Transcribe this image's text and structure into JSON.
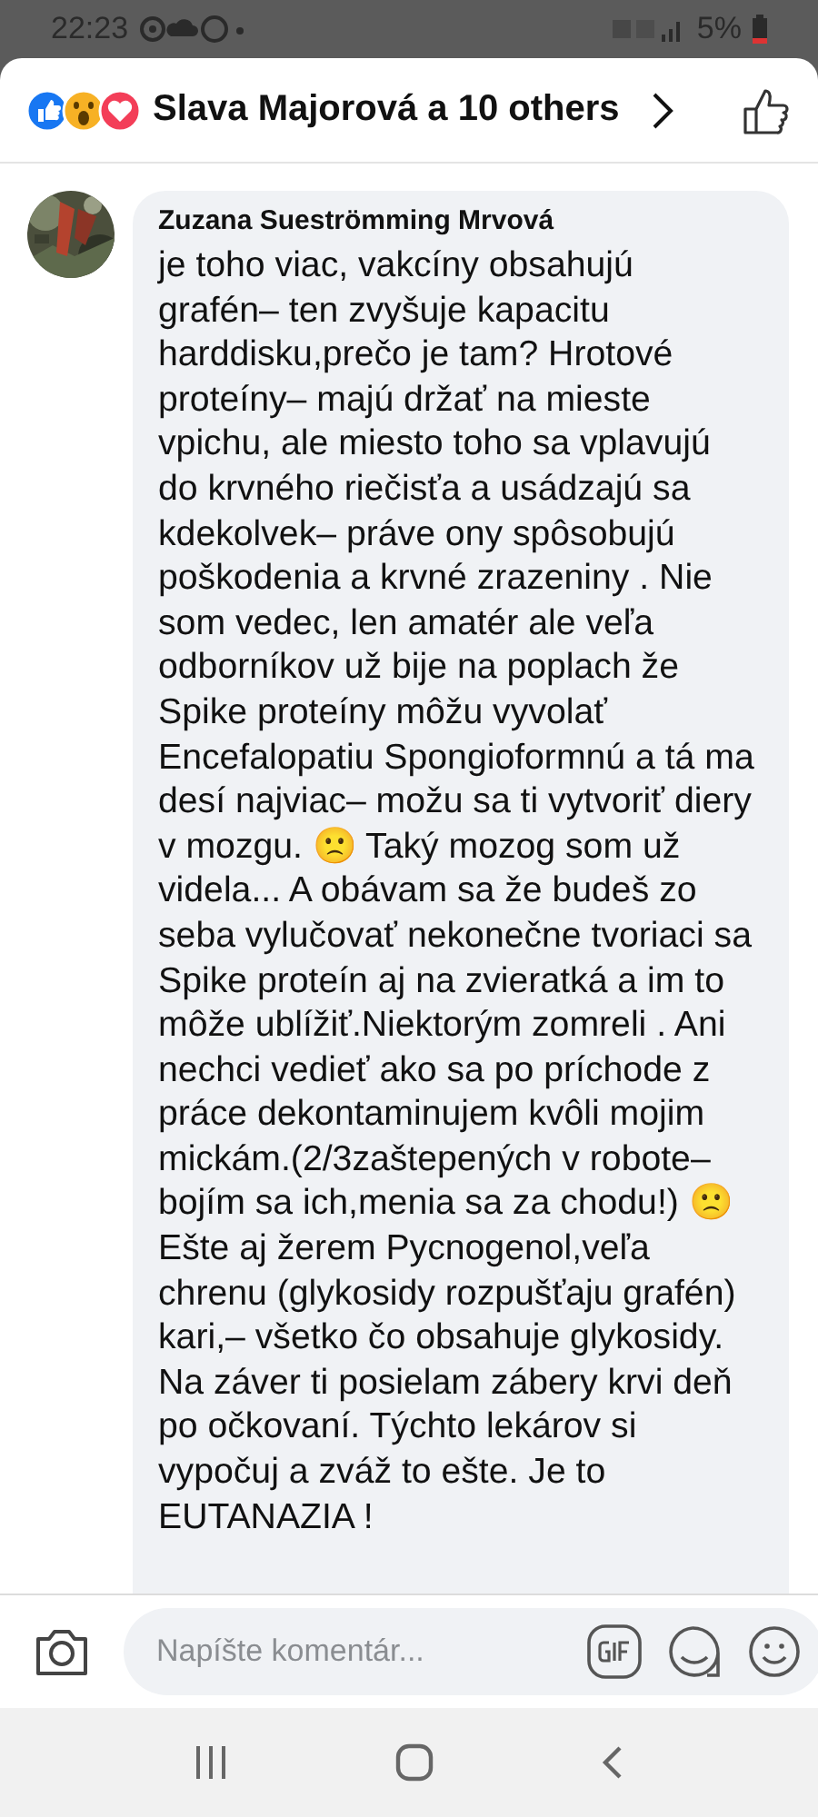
{
  "status_bar": {
    "time": "22:23",
    "battery": "5%"
  },
  "reactions": {
    "summary": "Slava Majorová a 10 others"
  },
  "comment": {
    "author": "Zuzana Sueströmming Mrvová",
    "text": "je toho viac, vakcíny obsahujú grafén– ten zvyšuje kapacitu harddisku,prečo je tam? Hrotové proteíny– majú držať na mieste vpichu, ale miesto toho sa vplavujú do krvného riečisťa a usádzajú sa kdekolvek– práve ony spôsobujú poškodenia a krvné zrazeniny . Nie som vedec, len amatér ale veľa odborníkov už bije na poplach že Spike proteíny môžu vyvolať Encefalopatiu Spongioformnú a tá ma desí najviac– možu sa ti vytvoriť diery v mozgu. 🙁 Taký mozog som už videla... A obávam sa že budeš zo seba vylučovať nekonečne tvoriaci sa Spike proteín aj na zvieratká a im to môže ublížiť.Niektorým zomreli . Ani nechci vedieť ako sa po príchode z práce dekontaminujem kvôli mojim mickám.(2/3zaštepených v robote– bojím sa ich,menia sa za chodu!) 🙁 Ešte aj žerem Pycnogenol,veľa chrenu (glykosidy rozpušťaju grafén) kari,– všetko čo obsahuje glykosidy. Na záver ti posielam zábery krvi deň po očkovaní. Týchto lekárov si vypočuj a zváž to ešte. Je to EUTANAZIA !"
  },
  "composer": {
    "placeholder": "Napíšte komentár..."
  }
}
